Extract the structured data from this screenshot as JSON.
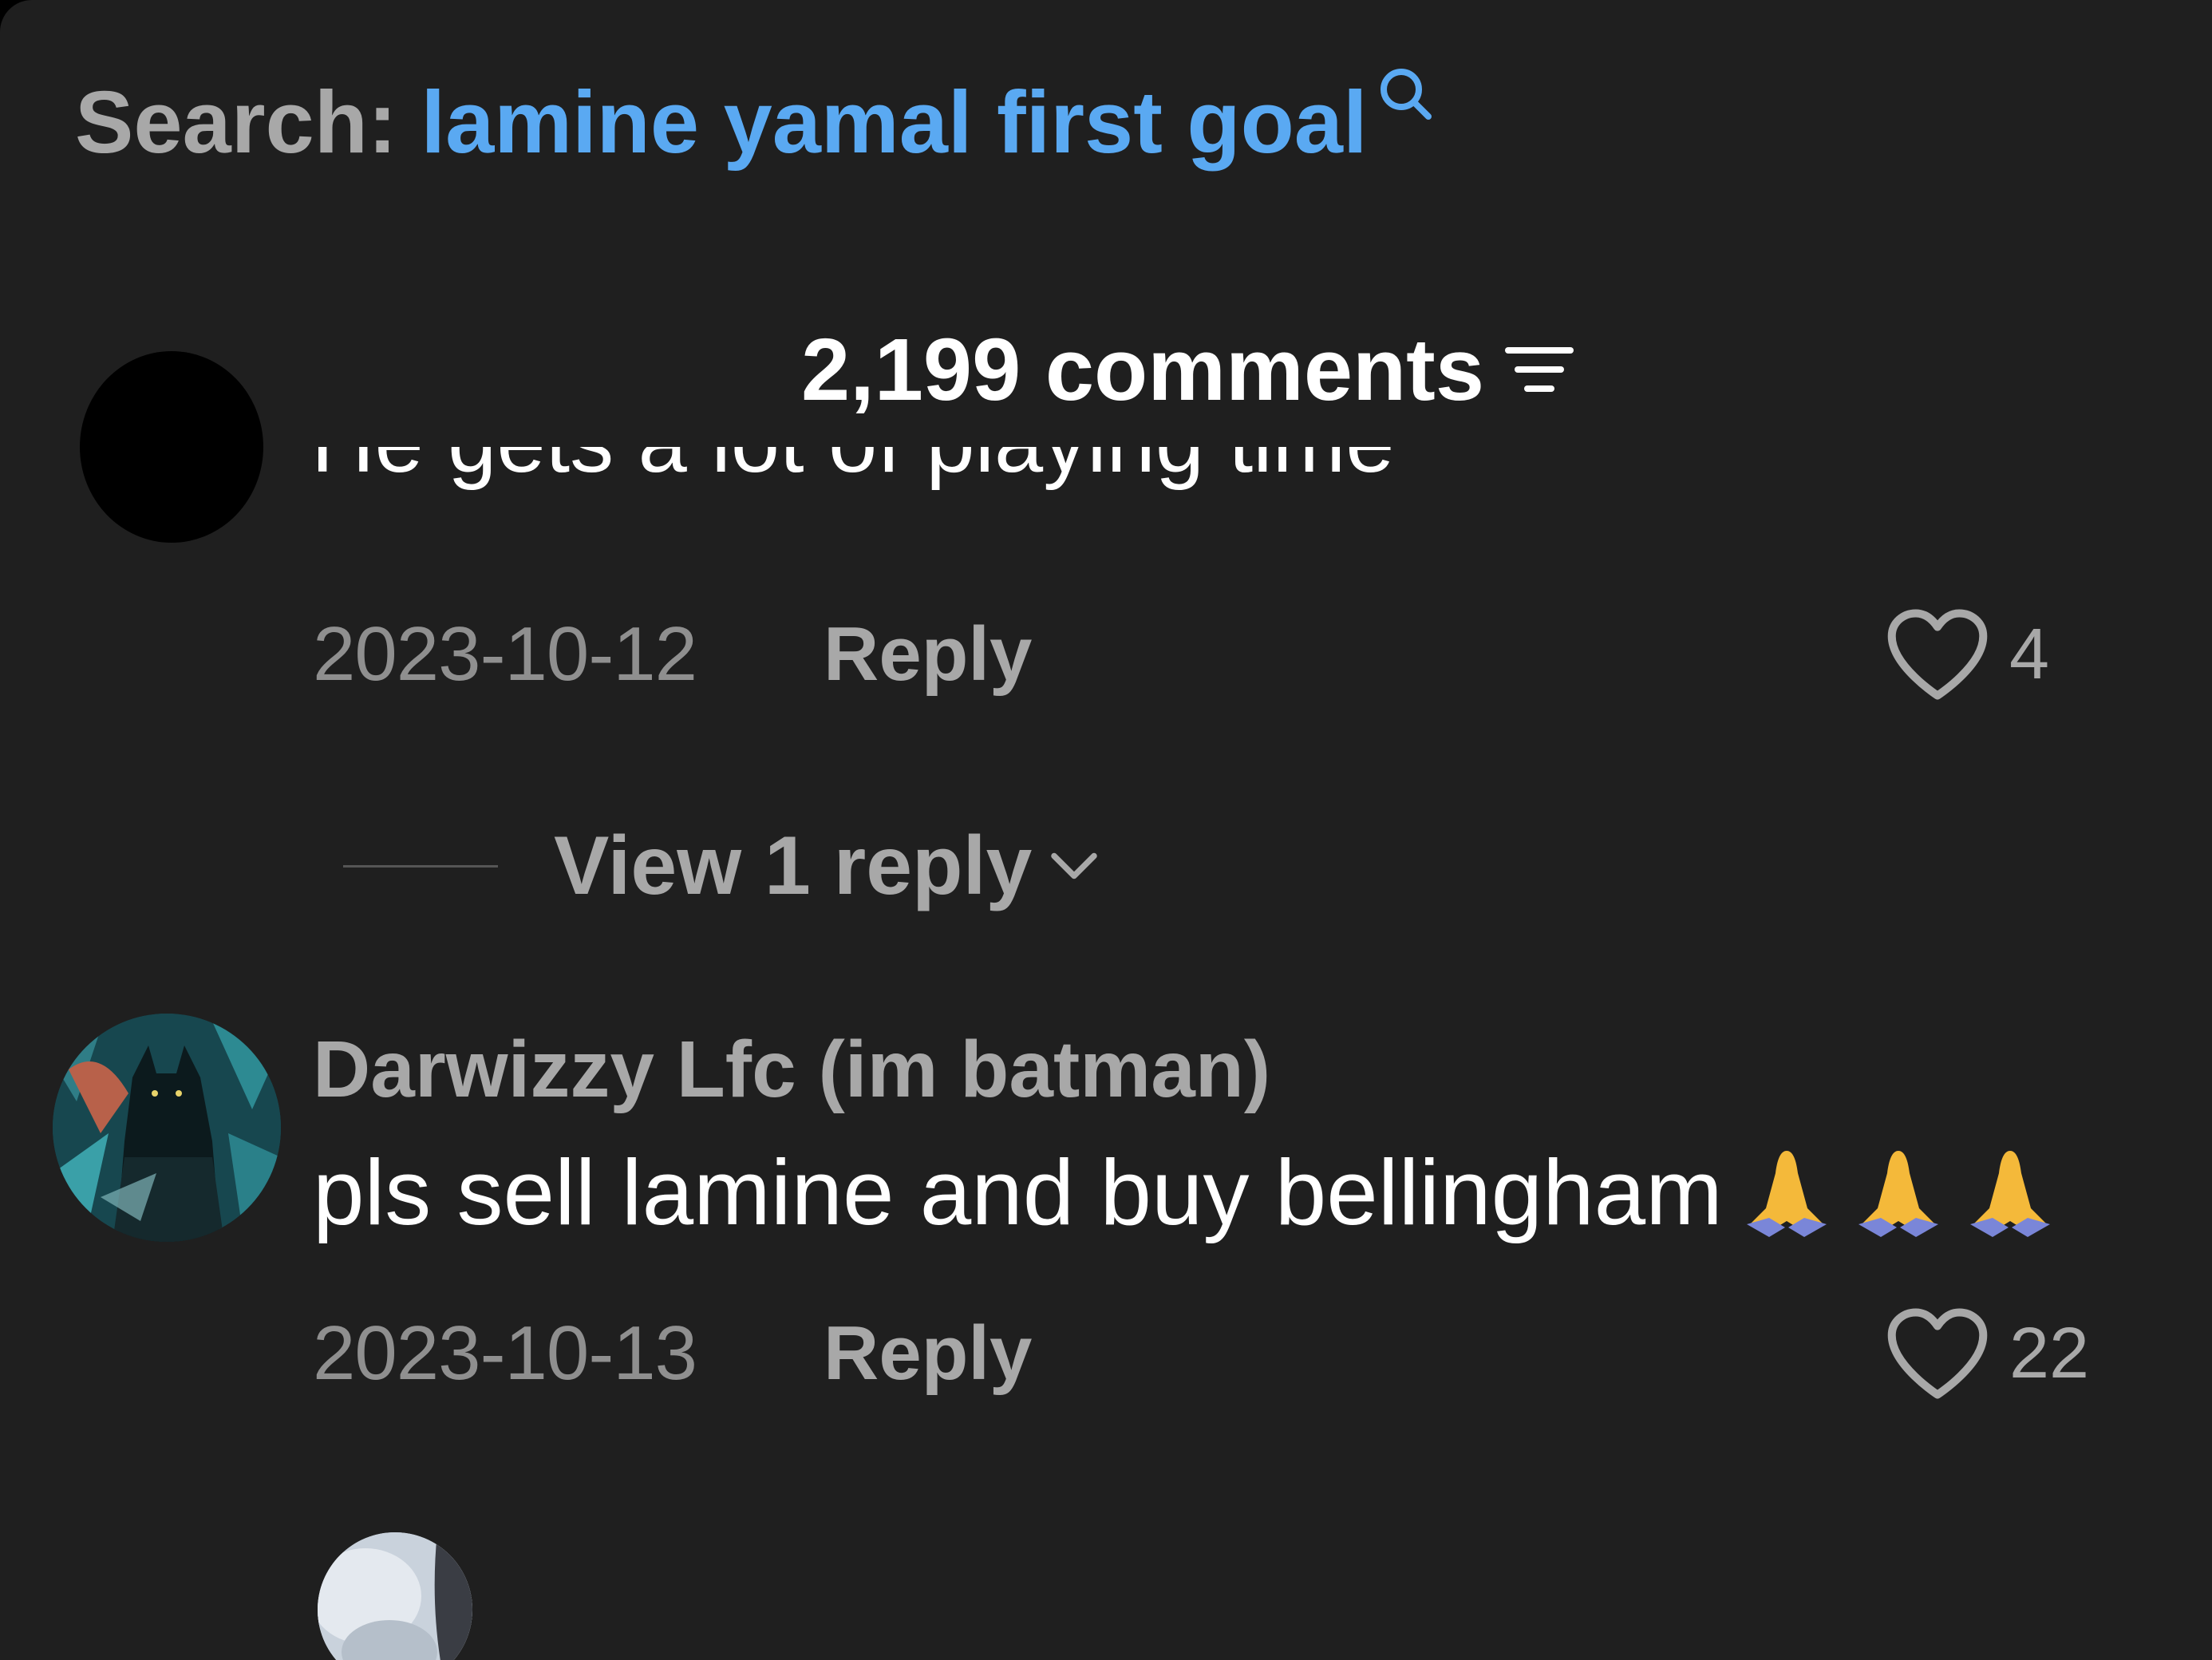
{
  "search": {
    "prefix": "Search:",
    "term": "lamine yamal first goal"
  },
  "comments_header": {
    "count_label": "2,199 comments"
  },
  "comments": [
    {
      "text_partial": "He gets a lot of playing time",
      "date": "2023-10-12",
      "reply_label": "Reply",
      "likes": "4",
      "view_replies_label": "View 1 reply"
    },
    {
      "author": "Darwizzy Lfc (im batman)",
      "text": "pls sell lamine and buy bellingham",
      "emoji": "🙏🙏🙏",
      "date": "2023-10-13",
      "reply_label": "Reply",
      "likes": "22"
    }
  ],
  "icons": {
    "search": "search-icon",
    "sort": "sort-icon",
    "like": "heart-outline-icon",
    "expand": "chevron-down-icon",
    "emoji": "folded-hands-emoji"
  },
  "colors": {
    "background": "#1f1f1f",
    "search_term": "#5aa9f2",
    "secondary_text": "#a8a8a8",
    "date_text": "#8f8f8f",
    "primary_text": "#ffffff"
  }
}
